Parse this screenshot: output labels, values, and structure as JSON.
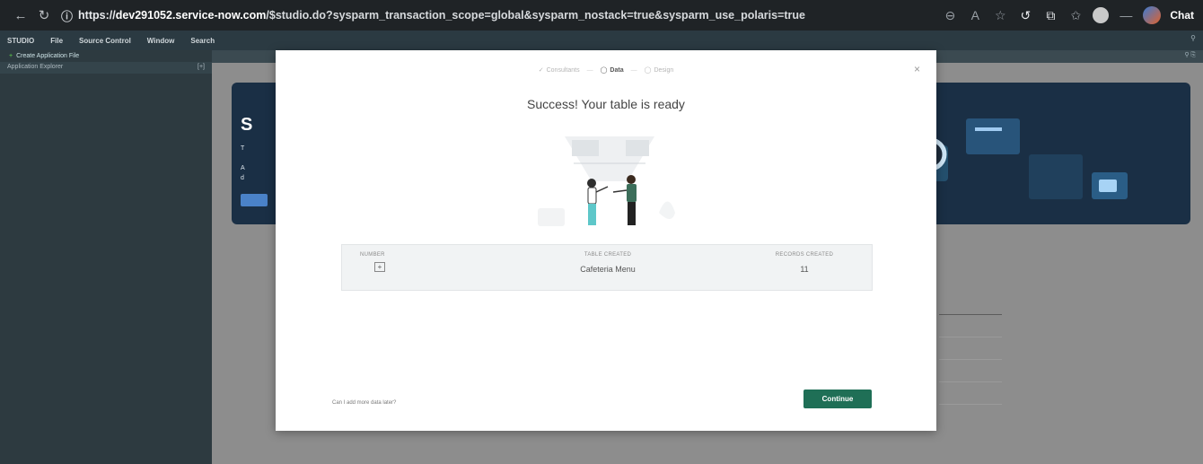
{
  "browser": {
    "url_prefix": "https://",
    "url_host": "dev291052.service-now.com",
    "url_path": "/$studio.do?sysparm_transaction_scope=global&sysparm_nostack=true&sysparm_use_polaris=true",
    "chat_label": "Chat"
  },
  "menu": {
    "items": [
      "STUDIO",
      "File",
      "Source Control",
      "Window",
      "Search"
    ]
  },
  "sidebar": {
    "create_label": "Create Application File",
    "explorer_label": "Application Explorer",
    "explorer_toggle": "[+]"
  },
  "modal": {
    "steps": [
      "Consultants",
      "Data",
      "Design"
    ],
    "title": "Success! Your table is ready",
    "result": {
      "number_header": "NUMBER",
      "table_header": "TABLE CREATED",
      "records_header": "RECORDS CREATED",
      "table_value": "Cafeteria Menu",
      "records_value": "11",
      "plus_symbol": "+"
    },
    "footer_link": "Can I add more data later?",
    "continue_label": "Continue",
    "close_symbol": "×"
  },
  "hero": {
    "letter": "S"
  }
}
